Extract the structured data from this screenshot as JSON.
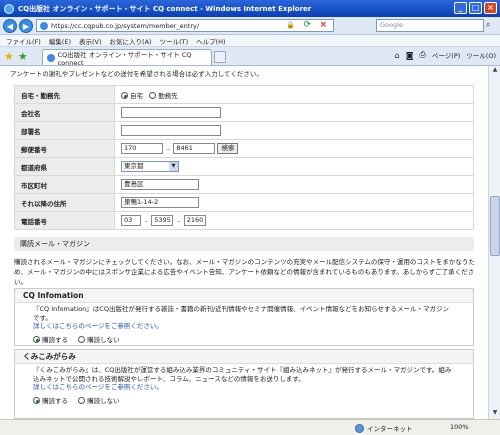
{
  "window": {
    "title": "CQ出版社 オンライン・サポート・サイト CQ connect - Windows Internet Explorer"
  },
  "address": {
    "url": "https://cc.cqpub.co.jp/system/member_entry/",
    "search_placeholder": "Google"
  },
  "menu": [
    "ファイル(F)",
    "編集(E)",
    "表示(V)",
    "お気に入り(A)",
    "ツール(T)",
    "ヘルプ(H)"
  ],
  "tab": {
    "label": "CQ出版社 オンライン・サポート・サイト CQ connect"
  },
  "commands": {
    "page": "ページ(P)",
    "tools": "ツール(O)"
  },
  "page": {
    "notice": "アンケートの謝礼やプレゼントなどの送付を希望される場合は必ず入力してください。",
    "form": {
      "home_work_label": "自宅・勤務先",
      "home_option": "自宅",
      "work_option": "勤務先",
      "company_label": "会社名",
      "department_label": "部署名",
      "zip_label": "郵便番号",
      "zip1": "170",
      "zip2": "8461",
      "search_button": "検索",
      "pref_label": "都道府県",
      "pref_value": "東京都",
      "city_label": "市区町村",
      "city_value": "豊島区",
      "address_label": "それ以降の住所",
      "address_value": "巣鴨1-14-2",
      "phone_label": "電話番号",
      "phone1": "03",
      "phone2": "5395",
      "phone3": "2160"
    },
    "mail_section": {
      "title": "購読メール・マガジン",
      "desc": "購読されるメール・マガジンにチェックしてください。なお、メール・マガジンのコンテンツの充実やメール配信システムの保守・運用のコストをまかなうため、メール・マガジンの中にはスポンサ企業による広告やイベント告知、アンケート依頼などの情報が含まれているものもあります。あしからずご了承ください。",
      "magazines": [
        {
          "name": "CQ Infomation",
          "desc": "『CQ Infomation』はCQ出版社が発行する雑誌・書籍の新刊/近刊情報やセミナ開催情報、イベント情報などをお知らせするメール・マガジンです。",
          "link": "詳しくはこちらのページをご参照ください。",
          "subscribe": "購読する",
          "unsubscribe": "購読しない"
        },
        {
          "name": "くみこみがらみ",
          "desc": "『くみこみがらみ』は、CQ出版社が運営する組み込み業界のコミュニティ・サイト『組み込みネット』が発行するメール・マガジンです。組み込みネットで公開される技術解説やレポート、コラム、ニュースなどの情報をお送りします。",
          "link": "詳しくはこちらのページをご参照ください。",
          "subscribe": "購読する",
          "unsubscribe": "購読しない"
        }
      ]
    }
  },
  "status": {
    "zone": "インターネット",
    "zoom": "100%"
  }
}
